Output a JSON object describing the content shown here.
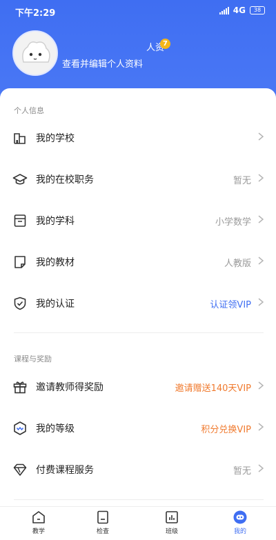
{
  "status_bar": {
    "time": "下午2:29",
    "network": "4G",
    "battery": "38"
  },
  "profile": {
    "name": "人资",
    "badge": "7",
    "edit_link": "查看并编辑个人资料"
  },
  "sections": {
    "personal": {
      "title": "个人信息",
      "items": [
        {
          "label": "我的学校",
          "value": "",
          "icon": "school-icon"
        },
        {
          "label": "我的在校职务",
          "value": "暂无",
          "icon": "graduation-cap-icon"
        },
        {
          "label": "我的学科",
          "value": "小学数学",
          "icon": "subject-icon"
        },
        {
          "label": "我的教材",
          "value": "人教版",
          "icon": "textbook-icon"
        },
        {
          "label": "我的认证",
          "value": "认证领VIP",
          "icon": "shield-check-icon"
        }
      ]
    },
    "rewards": {
      "title": "课程与奖励",
      "items": [
        {
          "label": "邀请教师得奖励",
          "value": "邀请赠送140天VIP",
          "icon": "gift-icon"
        },
        {
          "label": "我的等级",
          "value": "积分兑换VIP",
          "icon": "level-icon"
        },
        {
          "label": "付费课程服务",
          "value": "暂无",
          "icon": "diamond-icon"
        }
      ]
    }
  },
  "tabs": [
    {
      "label": "教学",
      "icon": "home-icon"
    },
    {
      "label": "检查",
      "icon": "check-doc-icon"
    },
    {
      "label": "班级",
      "icon": "class-chart-icon"
    },
    {
      "label": "我的",
      "icon": "robot-icon"
    }
  ],
  "colors": {
    "primary": "#3f6ef2",
    "accent_orange": "#f07a2e",
    "muted": "#9a9a9a"
  }
}
